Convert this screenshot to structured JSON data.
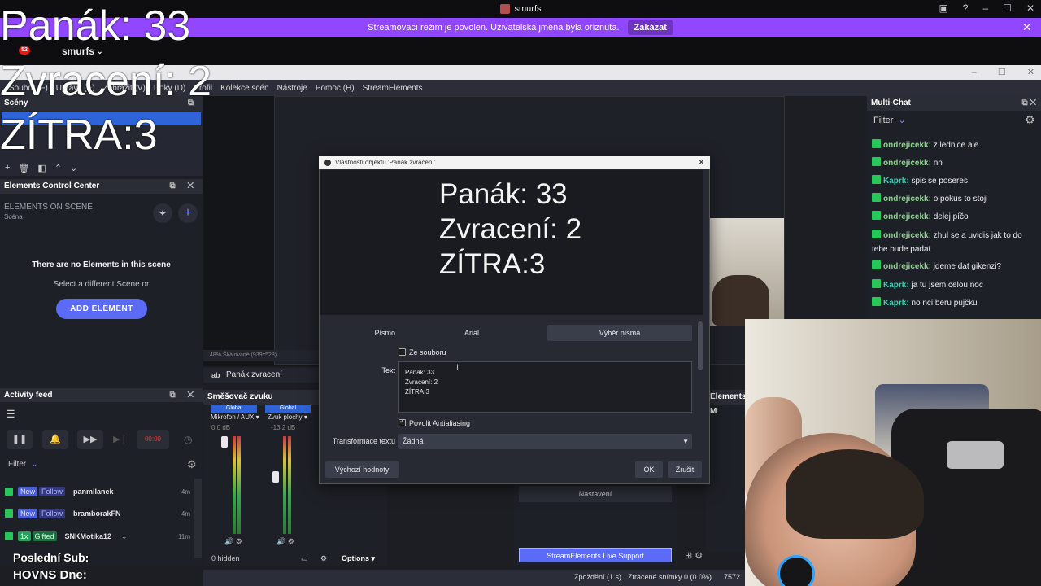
{
  "twitch": {
    "window_title": "smurfs",
    "streamer_mode_text": "Streamovací režim je povolen. Uživatelská jména byla oříznuta.",
    "streamer_mode_button": "Zakázat",
    "account_name": "smurfs",
    "notification_count": "52"
  },
  "obs": {
    "menu": [
      "Soubor (F)",
      "Upravit (E)",
      "Zobrazit (V)",
      "Doky (D)",
      "Profil",
      "Kolekce scén",
      "Nástroje",
      "Pomoc (H)",
      "StreamElements"
    ],
    "scenes_title": "Scény",
    "ecc_title": "Elements Control Center",
    "ecc_header": "ELEMENTS ON SCENE",
    "ecc_scene": "Scéna",
    "ecc_empty": "There are no Elements in this scene",
    "ecc_hint": "Select a different Scene or",
    "ecc_add": "ADD ELEMENT",
    "activity_title": "Activity feed",
    "activity_timer": "00:00",
    "activity_filter": "Filter",
    "activity_items": [
      {
        "tag1": "New",
        "tag2": "Follow",
        "name": "panmilanek",
        "time": "4m"
      },
      {
        "tag1": "New",
        "tag2": "Follow",
        "name": "bramborakFN",
        "time": "4m"
      },
      {
        "tag1": "1x",
        "tag2": "Gifted",
        "name": "SNKMotika12",
        "time": "11m"
      }
    ],
    "preview_footer": "48%   Škálované (939x528)",
    "source_name": "Panák zvracení",
    "mixer_title": "Směšovač zvuku",
    "mixer_channels": [
      {
        "head": "Global",
        "name": "Mikrofon / AUX",
        "db": "0.0 dB"
      },
      {
        "head": "Global",
        "name": "Zvuk plochy",
        "db": "-13.2 dB"
      }
    ],
    "mixer_hidden": "0 hidden",
    "mixer_options": "Options",
    "settings_button": "Nastavení",
    "se_support": "StreamElements Live Support",
    "status": {
      "delay": "Zpoždění (1 s)",
      "dropped": "Ztracené snímky 0 (0.0%)",
      "kbps": "7572"
    },
    "elements_dock_title": "Elements M"
  },
  "chat": {
    "title": "Multi-Chat",
    "filter": "Filter",
    "messages": [
      {
        "user": "ondrejicekk:",
        "text": "z lednice ale"
      },
      {
        "user": "ondrejicekk:",
        "text": "nn"
      },
      {
        "user": "Kaprk:",
        "text": "spis se poseres"
      },
      {
        "user": "ondrejicekk:",
        "text": "o pokus to stoji"
      },
      {
        "user": "ondrejicekk:",
        "text": "delej píčo"
      },
      {
        "user": "ondrejicekk:",
        "text": "zhul se a uvidis jak to do tebe bude padat"
      },
      {
        "user": "ondrejicekk:",
        "text": "jdeme dat gikenzi?"
      },
      {
        "user": "Kaprk:",
        "text": "ja tu jsem celou noc"
      },
      {
        "user": "Kaprk:",
        "text": "no nci beru pujčku"
      }
    ]
  },
  "dialog": {
    "title": "Vlastnosti objektu 'Panák zvracení'",
    "preview_text": "Panák: 33\nZvracení: 2\nZÍTRA:3",
    "font_label": "Písmo",
    "font_value": "Arial",
    "font_button": "Výběr písma",
    "from_file": "Ze souboru",
    "text_label": "Text",
    "text_value": "Panák: 33\nZvracení: 2\nZÍTRA:3",
    "antialias": "Povolit Antialiasing",
    "transform_label": "Transformace textu",
    "transform_value": "Žádná",
    "defaults_button": "Výchozí hodnoty",
    "ok_button": "OK",
    "cancel_button": "Zrušit"
  },
  "overlay": {
    "line1": "Panák: 33",
    "line2": "Zvracení: 2",
    "line3": "ZÍTRA:3",
    "bottom1": "Poslední Sub:",
    "bottom2": "HOVNS Dne:"
  }
}
